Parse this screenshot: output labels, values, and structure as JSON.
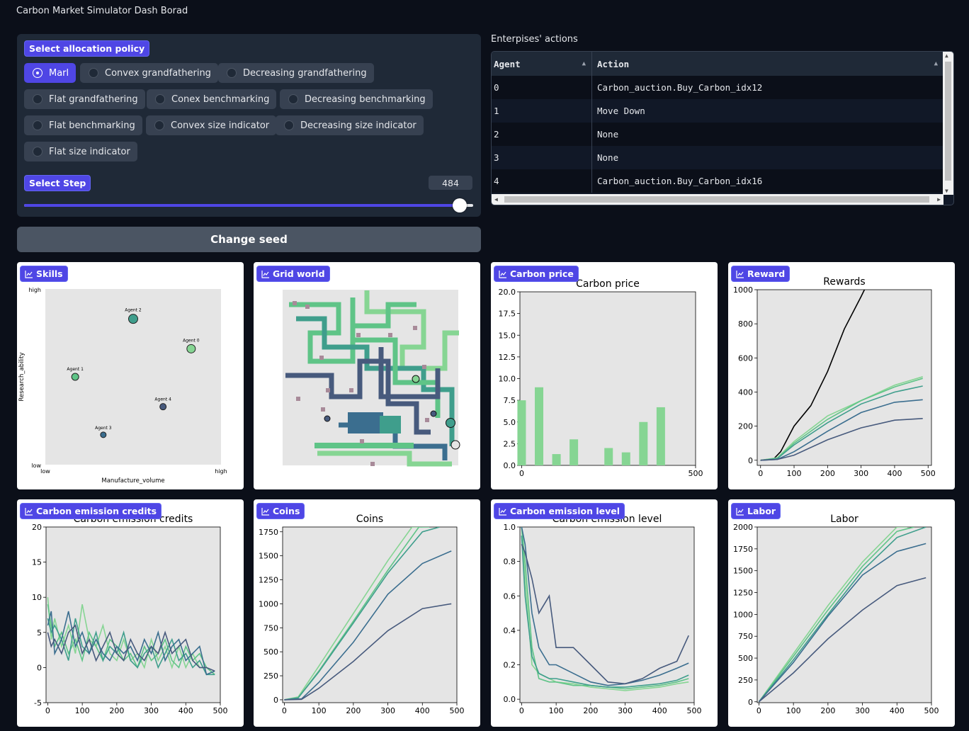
{
  "app_title": "Carbon Market Simulator Dash Borad",
  "policy": {
    "label": "Select allocation policy",
    "selected": "Marl",
    "options": [
      "Marl",
      "Convex grandfathering",
      "Decreasing grandfathering",
      "Flat grandfathering",
      "Conex benchmarking",
      "Decreasing benchmarking",
      "Flat benchmarking",
      "Convex size indicator",
      "Decreasing size indicator",
      "Flat size indicator"
    ]
  },
  "step": {
    "label": "Select Step",
    "value": "484",
    "fraction": 0.97
  },
  "change_seed_label": "Change seed",
  "actions_table": {
    "title": "Enterpises' actions",
    "columns": [
      "Agent",
      "Action"
    ],
    "rows": [
      [
        "0",
        "Carbon_auction.Buy_Carbon_idx12"
      ],
      [
        "1",
        "Move Down"
      ],
      [
        "2",
        "None"
      ],
      [
        "3",
        "None"
      ],
      [
        "4",
        "Carbon_auction.Buy_Carbon_idx16"
      ]
    ]
  },
  "tabs": {
    "skills": "Skills",
    "grid": "Grid world",
    "carbon_price": "Carbon price",
    "reward": "Reward",
    "credits": "Carbon emission credits",
    "coins": "Coins",
    "emission_level": "Carbon emission level",
    "labor": "Labor"
  },
  "colors": {
    "accent": "#4f46e5",
    "agent0": "#86d593",
    "agent1": "#5fc487",
    "agent2": "#3f9e8c",
    "agent3": "#3b6e8f",
    "agent4": "#475a7d",
    "plot_bg": "#e5e5e5"
  },
  "chart_data": [
    {
      "id": "skills",
      "type": "scatter",
      "xlabel": "Manufacture_volume",
      "ylabel": "Research_ability",
      "xtick_labels": [
        "low",
        "high"
      ],
      "ytick_labels": [
        "low",
        "high"
      ],
      "points": [
        {
          "label": "Agent 0",
          "x": 0.83,
          "y": 0.66
        },
        {
          "label": "Agent 1",
          "x": 0.17,
          "y": 0.5
        },
        {
          "label": "Agent 2",
          "x": 0.5,
          "y": 0.83
        },
        {
          "label": "Agent 3",
          "x": 0.33,
          "y": 0.17
        },
        {
          "label": "Agent 4",
          "x": 0.67,
          "y": 0.33
        }
      ]
    },
    {
      "id": "carbon_price",
      "type": "bar",
      "title": "Carbon price",
      "xlim": [
        -5,
        500
      ],
      "ylim": [
        0,
        20
      ],
      "xticks": [
        0,
        500
      ],
      "yticks": [
        0.0,
        2.5,
        5.0,
        7.5,
        10.0,
        12.5,
        15.0,
        17.5,
        20.0
      ],
      "x": [
        0,
        50,
        100,
        150,
        250,
        300,
        350,
        400
      ],
      "values": [
        7.5,
        9.0,
        1.3,
        3.0,
        2.0,
        1.5,
        5.0,
        6.7
      ]
    },
    {
      "id": "reward",
      "type": "line",
      "title": "Rewards",
      "xlim": [
        -10,
        510
      ],
      "ylim": [
        -30,
        1000
      ],
      "xticks": [
        0,
        100,
        200,
        300,
        400,
        500
      ],
      "yticks": [
        0,
        200,
        400,
        600,
        800,
        1000
      ],
      "series": [
        {
          "x": [
            0,
            40,
            60,
            100,
            150,
            200,
            250,
            300,
            310
          ],
          "y": [
            0,
            10,
            50,
            200,
            320,
            520,
            770,
            960,
            1000
          ]
        },
        {
          "x": [
            0,
            50,
            100,
            200,
            300,
            400,
            484
          ],
          "y": [
            0,
            15,
            110,
            260,
            350,
            440,
            490
          ]
        },
        {
          "x": [
            0,
            50,
            100,
            200,
            300,
            400,
            484
          ],
          "y": [
            0,
            10,
            100,
            240,
            350,
            430,
            480
          ]
        },
        {
          "x": [
            0,
            50,
            100,
            200,
            300,
            400,
            484
          ],
          "y": [
            0,
            10,
            90,
            220,
            330,
            400,
            435
          ]
        },
        {
          "x": [
            0,
            50,
            100,
            200,
            300,
            400,
            484
          ],
          "y": [
            0,
            5,
            50,
            170,
            280,
            340,
            355
          ]
        },
        {
          "x": [
            0,
            50,
            100,
            200,
            300,
            400,
            484
          ],
          "y": [
            0,
            5,
            30,
            120,
            190,
            235,
            245
          ]
        }
      ]
    },
    {
      "id": "credits",
      "type": "line",
      "title": "Carbon emission credits",
      "xlim": [
        -5,
        500
      ],
      "ylim": [
        -5,
        20
      ],
      "xticks": [
        0,
        100,
        200,
        300,
        400,
        500
      ],
      "yticks": [
        -5,
        0,
        5,
        10,
        15,
        20
      ],
      "series": [
        {
          "x": [
            0,
            10,
            20,
            40,
            60,
            80,
            100,
            120,
            140,
            160,
            180,
            200,
            220,
            240,
            260,
            280,
            300,
            320,
            340,
            360,
            380,
            400,
            420,
            440,
            460,
            484
          ],
          "y": [
            10,
            4,
            7,
            3,
            6,
            2,
            9,
            4,
            3,
            6,
            2,
            1,
            4,
            1,
            2,
            0,
            4,
            1,
            3,
            0,
            3,
            0,
            2,
            0,
            0,
            -1
          ]
        },
        {
          "x": [
            0,
            10,
            20,
            40,
            60,
            80,
            100,
            120,
            140,
            160,
            180,
            200,
            220,
            240,
            260,
            280,
            300,
            320,
            340,
            360,
            380,
            400,
            420,
            440,
            460,
            484
          ],
          "y": [
            9,
            6,
            3,
            5,
            2,
            4,
            1,
            5,
            3,
            1,
            4,
            3,
            1,
            2,
            0,
            3,
            1,
            2,
            4,
            1,
            0,
            3,
            1,
            2,
            0,
            -1
          ]
        },
        {
          "x": [
            0,
            10,
            20,
            40,
            60,
            80,
            100,
            120,
            140,
            160,
            180,
            200,
            220,
            240,
            260,
            280,
            300,
            320,
            340,
            360,
            380,
            400,
            420,
            440,
            460,
            484
          ],
          "y": [
            7,
            5,
            6,
            4,
            1,
            7,
            3,
            2,
            5,
            1,
            3,
            2,
            5,
            1,
            0,
            2,
            3,
            0,
            2,
            4,
            1,
            2,
            0,
            1,
            -1,
            -1
          ]
        },
        {
          "x": [
            0,
            10,
            20,
            40,
            60,
            80,
            100,
            120,
            140,
            160,
            180,
            200,
            220,
            240,
            260,
            280,
            300,
            320,
            340,
            360,
            380,
            400,
            420,
            440,
            460,
            484
          ],
          "y": [
            6,
            8,
            2,
            4,
            8,
            3,
            5,
            2,
            4,
            2,
            1,
            3,
            2,
            3,
            1,
            4,
            2,
            5,
            1,
            3,
            4,
            1,
            2,
            3,
            -1,
            -0.5
          ]
        },
        {
          "x": [
            0,
            10,
            20,
            40,
            60,
            80,
            100,
            120,
            140,
            160,
            180,
            200,
            220,
            240,
            260,
            280,
            300,
            320,
            340,
            360,
            380,
            400,
            420,
            440,
            460,
            484
          ],
          "y": [
            5,
            3,
            4,
            2,
            5,
            6,
            2,
            4,
            1,
            3,
            5,
            2,
            1,
            4,
            2,
            1,
            3,
            2,
            5,
            2,
            3,
            4,
            1,
            0,
            0,
            -0.5
          ]
        }
      ]
    },
    {
      "id": "coins",
      "type": "line",
      "title": "Coins",
      "xlim": [
        -5,
        500
      ],
      "ylim": [
        -30,
        1800
      ],
      "xticks": [
        0,
        100,
        200,
        300,
        400,
        500
      ],
      "yticks": [
        0,
        250,
        500,
        750,
        1000,
        1250,
        1500,
        1750
      ],
      "series": [
        {
          "x": [
            0,
            40,
            100,
            200,
            300,
            370,
            400
          ],
          "y": [
            0,
            30,
            350,
            900,
            1450,
            1800,
            1800
          ]
        },
        {
          "x": [
            0,
            40,
            100,
            200,
            300,
            390,
            420
          ],
          "y": [
            0,
            20,
            300,
            820,
            1350,
            1800,
            1800
          ]
        },
        {
          "x": [
            0,
            40,
            100,
            200,
            300,
            400,
            450
          ],
          "y": [
            0,
            20,
            290,
            800,
            1320,
            1750,
            1800
          ]
        },
        {
          "x": [
            0,
            50,
            100,
            200,
            300,
            400,
            484
          ],
          "y": [
            0,
            10,
            180,
            600,
            1100,
            1420,
            1550
          ]
        },
        {
          "x": [
            0,
            50,
            100,
            200,
            300,
            400,
            484
          ],
          "y": [
            0,
            5,
            120,
            400,
            720,
            950,
            1000
          ]
        }
      ]
    },
    {
      "id": "emission_level",
      "type": "line",
      "title": "Carbon emission level",
      "xlim": [
        -5,
        500
      ],
      "ylim": [
        -0.02,
        1.0
      ],
      "xticks": [
        0,
        100,
        200,
        300,
        400,
        500
      ],
      "yticks": [
        0.0,
        0.2,
        0.4,
        0.6,
        0.8,
        1.0
      ],
      "series": [
        {
          "x": [
            0,
            10,
            30,
            50,
            80,
            100,
            150,
            200,
            250,
            300,
            350,
            400,
            450,
            484
          ],
          "y": [
            1.0,
            0.7,
            0.2,
            0.15,
            0.12,
            0.1,
            0.09,
            0.07,
            0.06,
            0.05,
            0.06,
            0.07,
            0.09,
            0.1
          ]
        },
        {
          "x": [
            0,
            10,
            30,
            50,
            80,
            100,
            150,
            200,
            250,
            300,
            350,
            400,
            450,
            484
          ],
          "y": [
            1.0,
            0.8,
            0.3,
            0.12,
            0.1,
            0.1,
            0.08,
            0.08,
            0.07,
            0.06,
            0.07,
            0.08,
            0.1,
            0.12
          ]
        },
        {
          "x": [
            0,
            10,
            30,
            50,
            80,
            100,
            150,
            200,
            250,
            300,
            350,
            400,
            450,
            484
          ],
          "y": [
            0.95,
            0.6,
            0.25,
            0.15,
            0.12,
            0.12,
            0.1,
            0.08,
            0.07,
            0.07,
            0.08,
            0.09,
            0.11,
            0.14
          ]
        },
        {
          "x": [
            0,
            10,
            30,
            50,
            80,
            100,
            150,
            200,
            250,
            300,
            350,
            400,
            450,
            484
          ],
          "y": [
            1.0,
            0.9,
            0.5,
            0.3,
            0.2,
            0.2,
            0.15,
            0.1,
            0.08,
            0.09,
            0.11,
            0.14,
            0.18,
            0.21
          ]
        },
        {
          "x": [
            0,
            10,
            30,
            50,
            80,
            100,
            150,
            200,
            250,
            300,
            350,
            400,
            450,
            484
          ],
          "y": [
            0.9,
            0.85,
            0.7,
            0.5,
            0.6,
            0.3,
            0.3,
            0.2,
            0.1,
            0.09,
            0.12,
            0.18,
            0.22,
            0.37
          ]
        }
      ]
    },
    {
      "id": "labor",
      "type": "line",
      "title": "Labor",
      "xlim": [
        -5,
        500
      ],
      "ylim": [
        -10,
        2000
      ],
      "xticks": [
        0,
        100,
        200,
        300,
        400,
        500
      ],
      "yticks": [
        0,
        250,
        500,
        750,
        1000,
        1250,
        1500,
        1750,
        2000
      ],
      "series": [
        {
          "x": [
            0,
            100,
            200,
            300,
            400,
            430
          ],
          "y": [
            0,
            550,
            1100,
            1600,
            2000,
            2000
          ]
        },
        {
          "x": [
            0,
            100,
            200,
            300,
            400,
            450
          ],
          "y": [
            0,
            520,
            1050,
            1550,
            1950,
            2000
          ]
        },
        {
          "x": [
            0,
            100,
            200,
            300,
            400,
            484
          ],
          "y": [
            0,
            480,
            1000,
            1500,
            1880,
            2000
          ]
        },
        {
          "x": [
            0,
            100,
            200,
            300,
            400,
            484
          ],
          "y": [
            0,
            450,
            980,
            1450,
            1720,
            1810
          ]
        },
        {
          "x": [
            0,
            100,
            200,
            300,
            400,
            484
          ],
          "y": [
            0,
            330,
            720,
            1050,
            1330,
            1420
          ]
        }
      ]
    }
  ]
}
